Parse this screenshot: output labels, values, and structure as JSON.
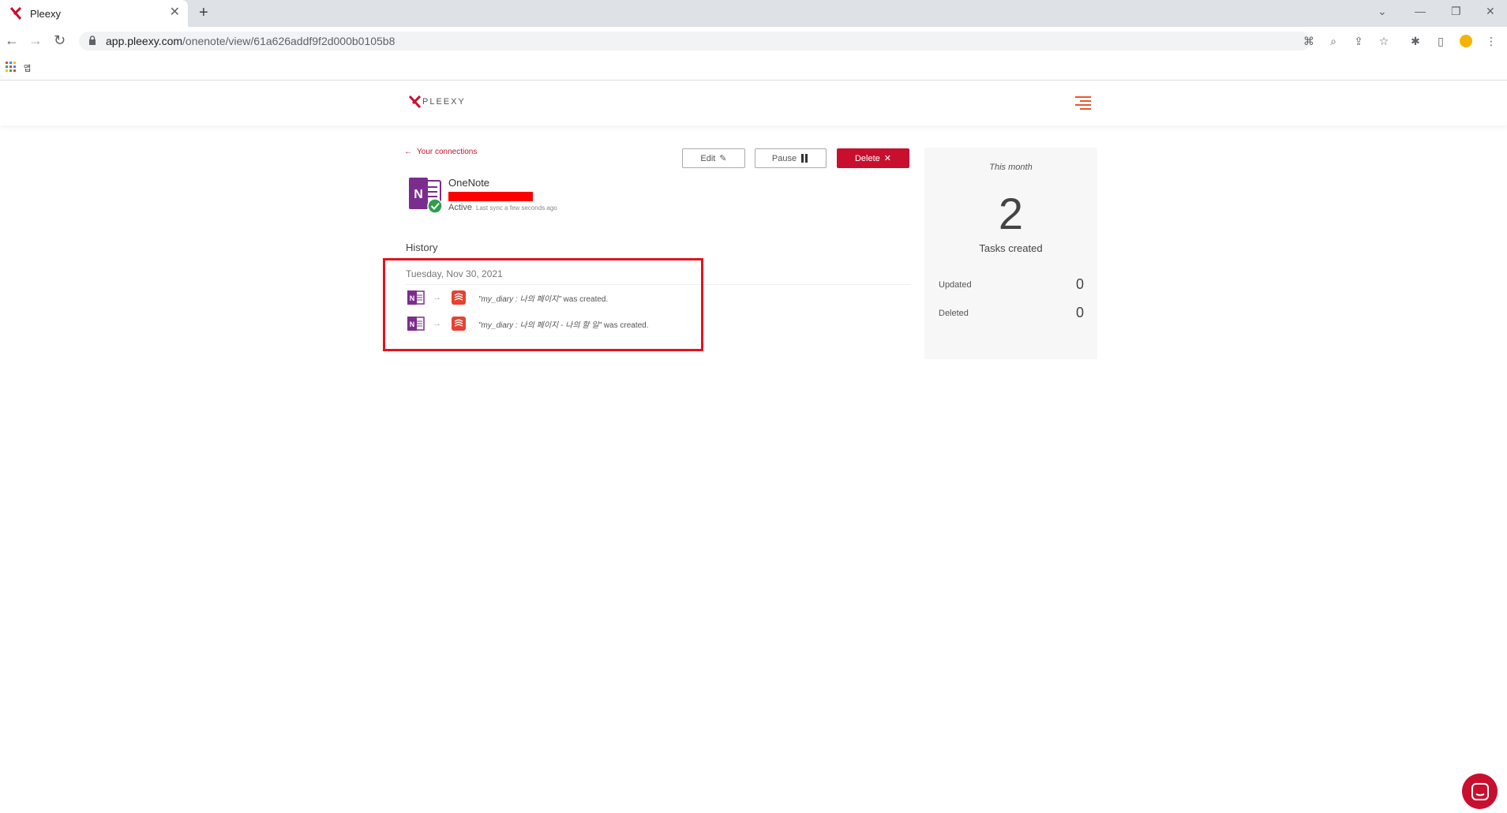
{
  "browser": {
    "tab_title": "Pleexy",
    "tab_close": "✕",
    "new_tab": "+",
    "url_host": "app.pleexy.com",
    "url_path": "/onenote/view/61a626addf9f2d000b0105b8",
    "bookmark_label": "앱"
  },
  "header": {
    "logo_text": "PLEEXY"
  },
  "connection": {
    "back_link": "Your connections",
    "name": "OneNote",
    "status": "Active",
    "last_sync": "Last sync a few seconds ago",
    "buttons": {
      "edit": "Edit",
      "pause": "Pause",
      "delete": "Delete"
    }
  },
  "history": {
    "title": "History",
    "date": "Tuesday, Nov 30, 2021",
    "items": [
      {
        "quoted": "\"my_diary : 나의 페이지\"",
        "suffix": " was created."
      },
      {
        "quoted": "\"my_diary : 나의 페이지 - 나의 할 일\"",
        "suffix": " was created."
      }
    ]
  },
  "stats": {
    "period": "This month",
    "tasks_created": "2",
    "tasks_created_label": "Tasks created",
    "updated_label": "Updated",
    "updated_value": "0",
    "deleted_label": "Deleted",
    "deleted_value": "0"
  },
  "colors": {
    "brand_red": "#c8102e",
    "onenote_purple": "#7b2d8e",
    "todoist_red": "#e44332",
    "hamburger_orange": "#e8562a",
    "annotation_box": "#e0141e"
  }
}
